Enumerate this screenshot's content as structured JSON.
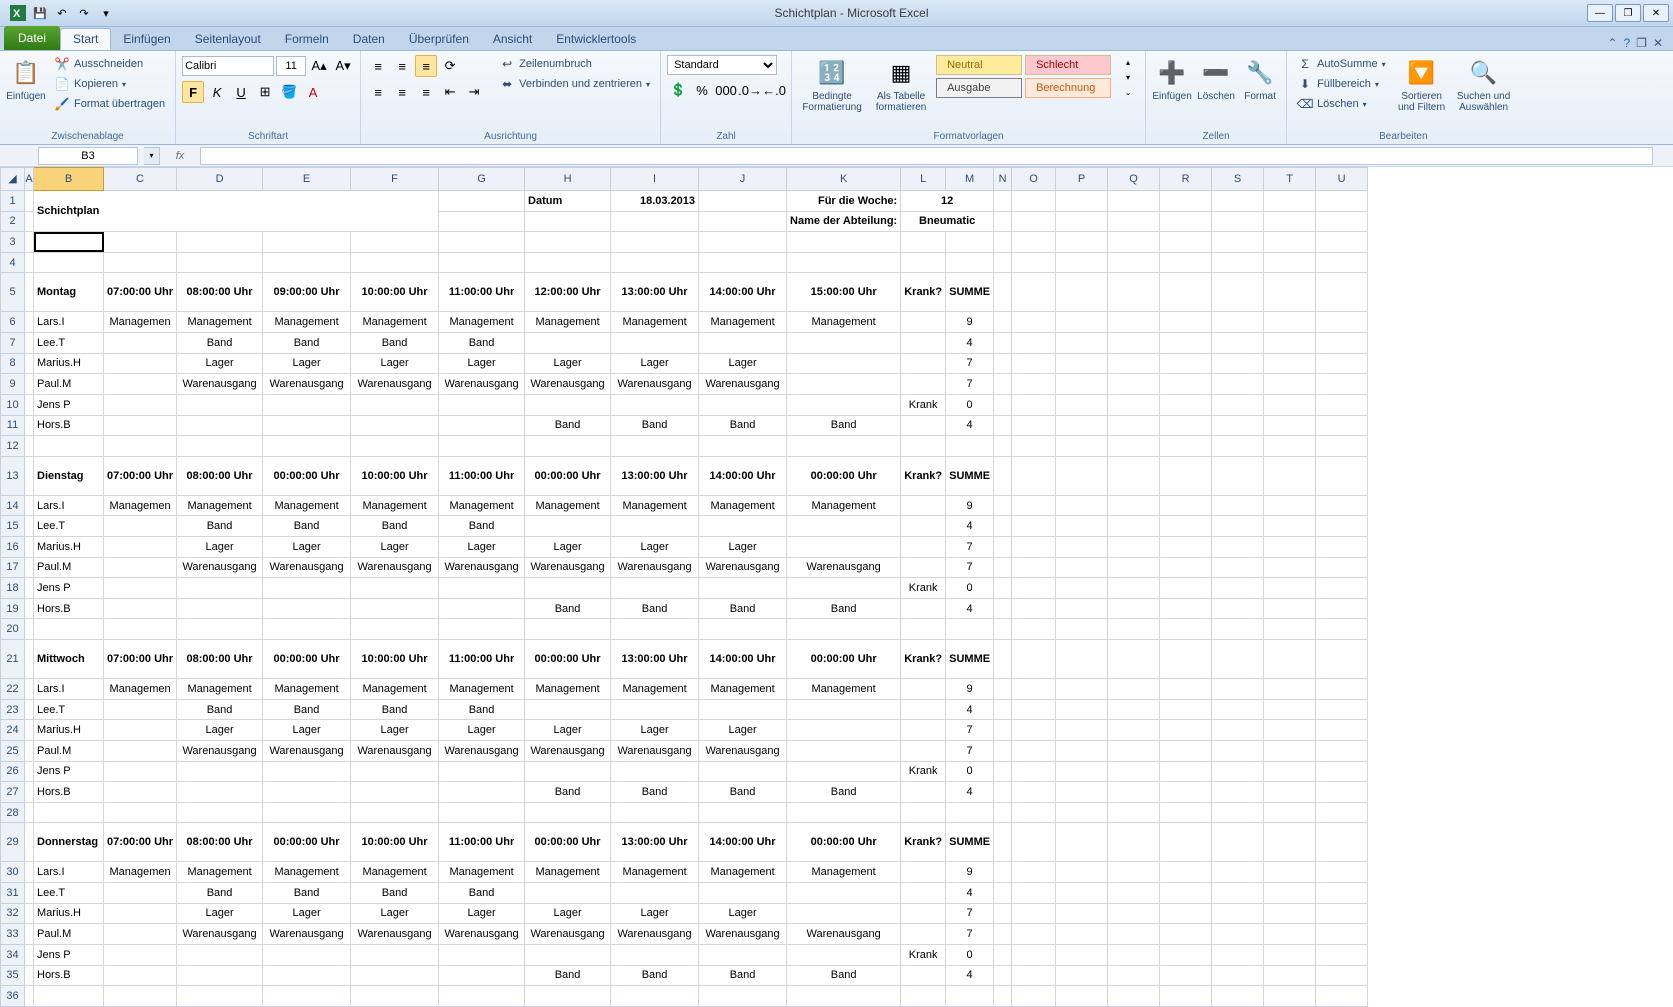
{
  "app": {
    "title": "Schichtplan - Microsoft Excel"
  },
  "tabs": {
    "file": "Datei",
    "list": [
      "Start",
      "Einfügen",
      "Seitenlayout",
      "Formeln",
      "Daten",
      "Überprüfen",
      "Ansicht",
      "Entwicklertools"
    ],
    "active": 0
  },
  "ribbon": {
    "clipboard": {
      "label": "Zwischenablage",
      "paste": "Einfügen",
      "cut": "Ausschneiden",
      "copy": "Kopieren",
      "painter": "Format übertragen"
    },
    "font": {
      "label": "Schriftart",
      "name": "Calibri",
      "size": "11"
    },
    "align": {
      "label": "Ausrichtung",
      "wrap": "Zeilenumbruch",
      "merge": "Verbinden und zentrieren"
    },
    "number": {
      "label": "Zahl",
      "format": "Standard"
    },
    "styles": {
      "label": "Formatvorlagen",
      "cond": "Bedingte\nFormatierung",
      "table": "Als Tabelle\nformatieren",
      "neutral": "Neutral",
      "bad": "Schlecht",
      "output": "Ausgabe",
      "calc": "Berechnung"
    },
    "cells": {
      "label": "Zellen",
      "insert": "Einfügen",
      "delete": "Löschen",
      "format": "Format"
    },
    "edit": {
      "label": "Bearbeiten",
      "sum": "AutoSumme",
      "fill": "Füllbereich",
      "clear": "Löschen",
      "sort": "Sortieren\nund Filtern",
      "find": "Suchen und\nAuswählen"
    }
  },
  "fx": {
    "name": "B3",
    "formula": ""
  },
  "cols": [
    "A",
    "B",
    "C",
    "D",
    "E",
    "F",
    "G",
    "H",
    "I",
    "J",
    "K",
    "L",
    "M",
    "N",
    "O",
    "P",
    "Q",
    "R",
    "S",
    "T",
    "U"
  ],
  "meta": {
    "title": "Schichtplan",
    "dateLabel": "Datum",
    "dateValue": "18.03.2013",
    "weekLabel": "Für die Woche:",
    "weekValue": "12",
    "deptLabel": "Name der Abteilung:",
    "deptValue": "Bneumatic"
  },
  "hdrs": {
    "krank": "Krank?",
    "summe": "SUMME"
  },
  "times_std": [
    "07:00:00 Uhr",
    "08:00:00 Uhr",
    "09:00:00 Uhr",
    "10:00:00 Uhr",
    "11:00:00 Uhr",
    "12:00:00 Uhr",
    "13:00:00 Uhr",
    "14:00:00 Uhr",
    "15:00:00 Uhr"
  ],
  "times_alt": [
    "07:00:00 Uhr",
    "08:00:00 Uhr",
    "00:00:00 Uhr",
    "10:00:00 Uhr",
    "11:00:00 Uhr",
    "00:00:00 Uhr",
    "13:00:00 Uhr",
    "14:00:00 Uhr",
    "00:00:00 Uhr"
  ],
  "people": [
    "Lars.I",
    "Lee.T",
    "Marius.H",
    "Paul.M",
    "Jens P",
    "Hors.B"
  ],
  "days": [
    {
      "name": "Montag",
      "timeKey": "times_std",
      "rows": [
        {
          "p": 0,
          "vals": [
            "Managemen",
            "Management",
            "Management",
            "Management",
            "Management",
            "Management",
            "Management",
            "Management",
            "Management"
          ],
          "krank": "",
          "sum": "9"
        },
        {
          "p": 1,
          "vals": [
            "",
            "Band",
            "Band",
            "Band",
            "Band",
            "",
            "",
            "",
            ""
          ],
          "krank": "",
          "sum": "4"
        },
        {
          "p": 2,
          "vals": [
            "",
            "Lager",
            "Lager",
            "Lager",
            "Lager",
            "Lager",
            "Lager",
            "Lager",
            ""
          ],
          "krank": "",
          "sum": "7"
        },
        {
          "p": 3,
          "vals": [
            "",
            "Warenausgang",
            "Warenausgang",
            "Warenausgang",
            "Warenausgang",
            "Warenausgang",
            "Warenausgang",
            "Warenausgang",
            ""
          ],
          "krank": "",
          "sum": "7"
        },
        {
          "p": 4,
          "vals": [
            "",
            "",
            "",
            "",
            "",
            "",
            "",
            "",
            ""
          ],
          "krank": "Krank",
          "sum": "0"
        },
        {
          "p": 5,
          "vals": [
            "",
            "",
            "",
            "",
            "",
            "Band",
            "Band",
            "Band",
            "Band"
          ],
          "krank": "",
          "sum": "4"
        }
      ]
    },
    {
      "name": "Dienstag",
      "timeKey": "times_alt",
      "rows": [
        {
          "p": 0,
          "vals": [
            "Managemen",
            "Management",
            "Management",
            "Management",
            "Management",
            "Management",
            "Management",
            "Management",
            "Management"
          ],
          "krank": "",
          "sum": "9"
        },
        {
          "p": 1,
          "vals": [
            "",
            "Band",
            "Band",
            "Band",
            "Band",
            "",
            "",
            "",
            ""
          ],
          "krank": "",
          "sum": "4"
        },
        {
          "p": 2,
          "vals": [
            "",
            "Lager",
            "Lager",
            "Lager",
            "Lager",
            "Lager",
            "Lager",
            "Lager",
            ""
          ],
          "krank": "",
          "sum": "7"
        },
        {
          "p": 3,
          "vals": [
            "",
            "Warenausgang",
            "Warenausgang",
            "Warenausgang",
            "Warenausgang",
            "Warenausgang",
            "Warenausgang",
            "Warenausgang",
            "Warenausgang"
          ],
          "krank": "",
          "sum": "7"
        },
        {
          "p": 4,
          "vals": [
            "",
            "",
            "",
            "",
            "",
            "",
            "",
            "",
            ""
          ],
          "krank": "Krank",
          "sum": "0"
        },
        {
          "p": 5,
          "vals": [
            "",
            "",
            "",
            "",
            "",
            "Band",
            "Band",
            "Band",
            "Band"
          ],
          "krank": "",
          "sum": "4"
        }
      ]
    },
    {
      "name": "Mittwoch",
      "timeKey": "times_alt",
      "rows": [
        {
          "p": 0,
          "vals": [
            "Managemen",
            "Management",
            "Management",
            "Management",
            "Management",
            "Management",
            "Management",
            "Management",
            "Management"
          ],
          "krank": "",
          "sum": "9"
        },
        {
          "p": 1,
          "vals": [
            "",
            "Band",
            "Band",
            "Band",
            "Band",
            "",
            "",
            "",
            ""
          ],
          "krank": "",
          "sum": "4"
        },
        {
          "p": 2,
          "vals": [
            "",
            "Lager",
            "Lager",
            "Lager",
            "Lager",
            "Lager",
            "Lager",
            "Lager",
            ""
          ],
          "krank": "",
          "sum": "7"
        },
        {
          "p": 3,
          "vals": [
            "",
            "Warenausgang",
            "Warenausgang",
            "Warenausgang",
            "Warenausgang",
            "Warenausgang",
            "Warenausgang",
            "Warenausgang",
            ""
          ],
          "krank": "",
          "sum": "7"
        },
        {
          "p": 4,
          "vals": [
            "",
            "",
            "",
            "",
            "",
            "",
            "",
            "",
            ""
          ],
          "krank": "Krank",
          "sum": "0"
        },
        {
          "p": 5,
          "vals": [
            "",
            "",
            "",
            "",
            "",
            "Band",
            "Band",
            "Band",
            "Band"
          ],
          "krank": "",
          "sum": "4"
        }
      ]
    },
    {
      "name": "Donnerstag",
      "timeKey": "times_alt",
      "rows": [
        {
          "p": 0,
          "vals": [
            "Managemen",
            "Management",
            "Management",
            "Management",
            "Management",
            "Management",
            "Management",
            "Management",
            "Management"
          ],
          "krank": "",
          "sum": "9"
        },
        {
          "p": 1,
          "vals": [
            "",
            "Band",
            "Band",
            "Band",
            "Band",
            "",
            "",
            "",
            ""
          ],
          "krank": "",
          "sum": "4"
        },
        {
          "p": 2,
          "vals": [
            "",
            "Lager",
            "Lager",
            "Lager",
            "Lager",
            "Lager",
            "Lager",
            "Lager",
            ""
          ],
          "krank": "",
          "sum": "7"
        },
        {
          "p": 3,
          "vals": [
            "",
            "Warenausgang",
            "Warenausgang",
            "Warenausgang",
            "Warenausgang",
            "Warenausgang",
            "Warenausgang",
            "Warenausgang",
            "Warenausgang"
          ],
          "krank": "",
          "sum": "7"
        },
        {
          "p": 4,
          "vals": [
            "",
            "",
            "",
            "",
            "",
            "",
            "",
            "",
            ""
          ],
          "krank": "Krank",
          "sum": "0"
        },
        {
          "p": 5,
          "vals": [
            "",
            "",
            "",
            "",
            "",
            "Band",
            "Band",
            "Band",
            "Band"
          ],
          "krank": "",
          "sum": "4"
        }
      ]
    }
  ]
}
